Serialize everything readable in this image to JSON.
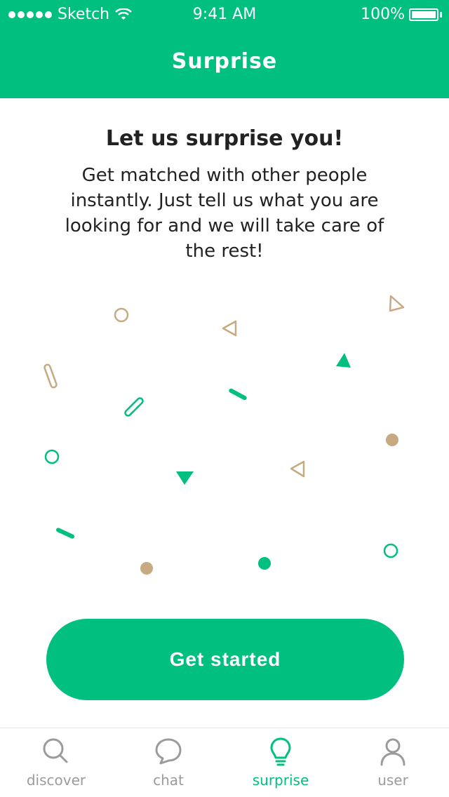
{
  "status_bar": {
    "carrier": "Sketch",
    "time": "9:41 AM",
    "battery": "100%"
  },
  "nav": {
    "title": "Surprise"
  },
  "content": {
    "heading": "Let us surprise you!",
    "description": "Get matched with other people instantly. Just tell us what you are looking for and we will take care of the rest!"
  },
  "cta": {
    "label": "Get started"
  },
  "tabbar": {
    "items": [
      {
        "label": "discover",
        "icon": "search-icon"
      },
      {
        "label": "chat",
        "icon": "chat-bubble-icon"
      },
      {
        "label": "surprise",
        "icon": "lightbulb-icon"
      },
      {
        "label": "user",
        "icon": "user-icon"
      }
    ]
  },
  "colors": {
    "brand_green": "#00bf7f",
    "accent_tan": "#c8aa82",
    "inactive_gray": "#9b9b9b"
  }
}
